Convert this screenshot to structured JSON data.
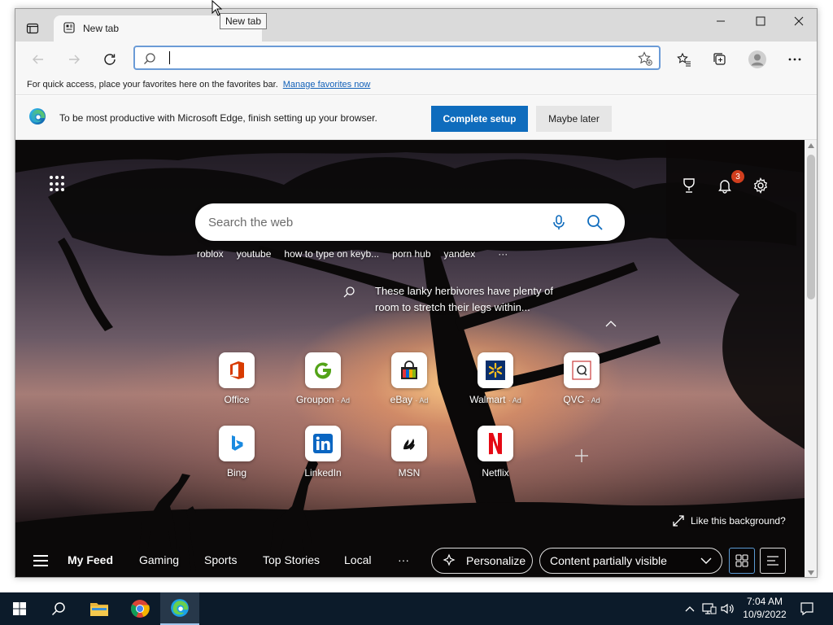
{
  "tooltip": "New tab",
  "tab": {
    "title": "New tab"
  },
  "toolbar": {
    "address_value": "",
    "address_placeholder": ""
  },
  "favorites_bar": {
    "message": "For quick access, place your favorites here on the favorites bar.",
    "link": "Manage favorites now"
  },
  "infobar": {
    "message": "To be most productive with Microsoft Edge, finish setting up your browser.",
    "primary_button": "Complete setup",
    "secondary_button": "Maybe later"
  },
  "ntp": {
    "notification_count": "3",
    "search": {
      "placeholder": "Search the web"
    },
    "suggestions": [
      "roblox",
      "youtube",
      "how to type on keyb...",
      "porn hub",
      "yandex",
      "···"
    ],
    "caption": "These lanky herbivores have plenty of room to stretch their legs within...",
    "tiles": [
      {
        "label": "Office",
        "ad": ""
      },
      {
        "label": "Groupon",
        "ad": "· Ad"
      },
      {
        "label": "eBay",
        "ad": "· Ad"
      },
      {
        "label": "Walmart",
        "ad": "· Ad"
      },
      {
        "label": "QVC",
        "ad": "· Ad"
      },
      {
        "label": "Bing",
        "ad": ""
      },
      {
        "label": "LinkedIn",
        "ad": ""
      },
      {
        "label": "MSN",
        "ad": ""
      },
      {
        "label": "Netflix",
        "ad": ""
      }
    ],
    "like_background": "Like this background?",
    "feed": {
      "tabs": [
        "My Feed",
        "Gaming",
        "Sports",
        "Top Stories",
        "Local"
      ],
      "more": "···",
      "personalize": "Personalize",
      "visibility": "Content partially visible"
    }
  },
  "taskbar": {
    "time": "7:04 AM",
    "date": "10/9/2022"
  },
  "colors": {
    "accent": "#0f6cbd",
    "taskbar": "#0c1b2a",
    "badge": "#d13e1e"
  }
}
